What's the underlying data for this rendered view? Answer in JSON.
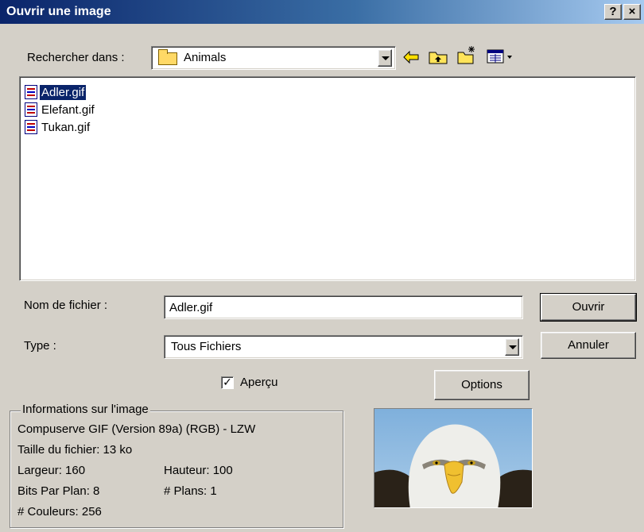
{
  "window": {
    "title": "Ouvrir une image",
    "help_label": "?",
    "close_label": "×"
  },
  "lookin": {
    "label": "Rechercher dans :",
    "value": "Animals"
  },
  "files": [
    {
      "name": "Adler.gif",
      "selected": true
    },
    {
      "name": "Elefant.gif",
      "selected": false
    },
    {
      "name": "Tukan.gif",
      "selected": false
    }
  ],
  "filename": {
    "label": "Nom de fichier :",
    "value": "Adler.gif"
  },
  "filetype": {
    "label": "Type :",
    "value": "Tous Fichiers"
  },
  "buttons": {
    "open": "Ouvrir",
    "cancel": "Annuler",
    "options": "Options"
  },
  "preview": {
    "label": "Aperçu",
    "checked": true
  },
  "info": {
    "legend": "Informations sur l'image",
    "format": "Compuserve GIF (Version 89a) (RGB) - LZW",
    "filesize": "Taille du fichier: 13 ko",
    "width": "Largeur: 160",
    "height": "Hauteur: 100",
    "bits": "Bits Par Plan: 8",
    "planes": "# Plans: 1",
    "colors": "# Couleurs:  256"
  },
  "colors": {
    "title_start": "#0a246a",
    "title_end": "#a6caf0",
    "face": "#d4d0c8",
    "selection": "#0a246a"
  }
}
